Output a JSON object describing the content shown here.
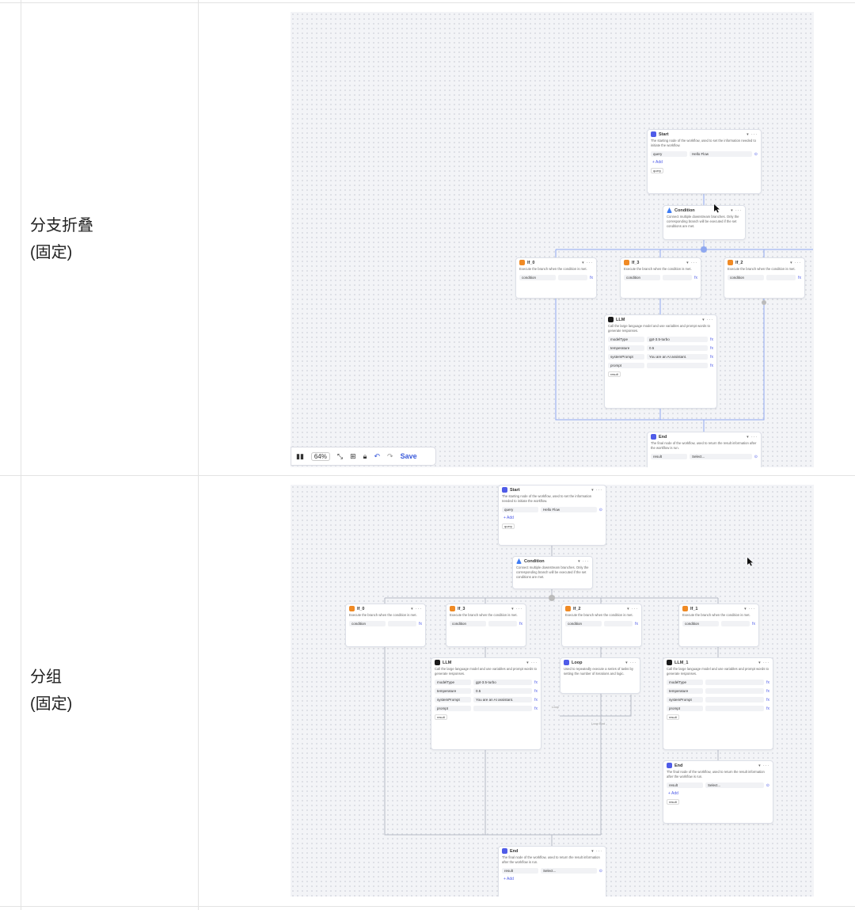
{
  "rows": [
    {
      "label_line1": "分支折叠",
      "label_line2": "(固定)"
    },
    {
      "label_line1": "分组",
      "label_line2": "(固定)"
    }
  ],
  "nodes": {
    "start": {
      "title": "Start",
      "desc": "The starting node of the workflow, used to set the information needed to initiate the workflow.",
      "field_name": "query",
      "field_value": "Hello Flow",
      "add": "+ Add",
      "output": "query"
    },
    "condition": {
      "title": "Condition",
      "desc": "Connect multiple downstream branches. Only the corresponding branch will be executed if the set conditions are met."
    },
    "if_desc": "Execute the branch when the condition is met.",
    "if_field": "condition",
    "llm": {
      "title": "LLM",
      "desc": "Call the large language model and use variables and prompt words to generate responses.",
      "f1": "modelType",
      "v1": "gpt-3.5-turbo",
      "f2": "temperature",
      "v2": "0.5",
      "f3": "systemPrompt",
      "v3": "You are an AI assistant.",
      "f4": "prompt",
      "output": "result"
    },
    "llm_1": {
      "title": "LLM_1"
    },
    "loop": {
      "title": "Loop",
      "desc": "Used to repeatedly execute a series of tasks by setting the number of iterations and logic.",
      "label_a": "Loop",
      "label_b": "Loop End"
    },
    "end": {
      "title": "End",
      "desc": "The final node of the workflow, used to return the result information after the workflow is run.",
      "field_name": "result",
      "select": "Select...",
      "add": "+ Add",
      "output": "result"
    },
    "if_titles_1": [
      "If_0",
      "If_3",
      "If_2"
    ],
    "if_titles_2": [
      "If_0",
      "If_3",
      "If_2",
      "If_1"
    ]
  },
  "toolbar": {
    "zoom": "64%",
    "save": "Save"
  }
}
